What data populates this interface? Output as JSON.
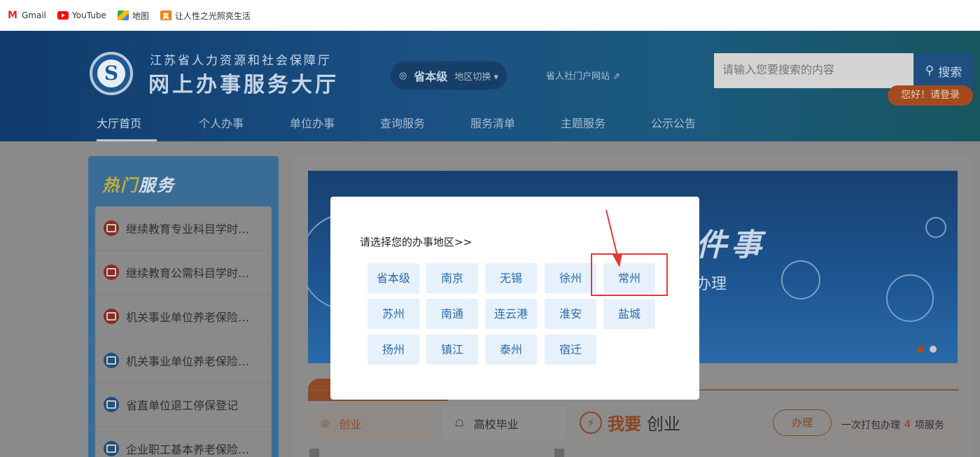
{
  "bookmarks": [
    {
      "label": "Gmail",
      "icon": "gmail-icon",
      "glyph": "M"
    },
    {
      "label": "YouTube",
      "icon": "youtube-icon",
      "glyph": ""
    },
    {
      "label": "地图",
      "icon": "maps-icon",
      "glyph": ""
    },
    {
      "label": "让人性之光照亮生活",
      "icon": "site-icon",
      "glyph": "真"
    }
  ],
  "header": {
    "org_name": "江苏省人力资源和社会保障厅",
    "hall_name": "网上办事服务大厅",
    "logo_glyph": "S",
    "region": {
      "pin": "◎",
      "current": "省本级",
      "switch_label": "地区切换 ▾"
    },
    "portal_link": "省人社门户网站 ⇗",
    "search": {
      "placeholder": "请输入您要搜索的内容",
      "button_label": "搜索",
      "button_icon": "⚲"
    },
    "nav": [
      "大厅首页",
      "个人办事",
      "单位办事",
      "查询服务",
      "服务清单",
      "主题服务",
      "公示公告"
    ],
    "login_label": "您好！请登录"
  },
  "sidebar": {
    "title_em": "热门",
    "title_rest": "服务",
    "items": [
      {
        "label": "继续教育专业科目学时…",
        "color": "red"
      },
      {
        "label": "继续教育公需科目学时…",
        "color": "red"
      },
      {
        "label": "机关事业单位养老保险…",
        "color": "red"
      },
      {
        "label": "机关事业单位养老保险…",
        "color": "blue"
      },
      {
        "label": "省直单位退工停保登记",
        "color": "blue"
      },
      {
        "label": "企业职工基本养老保险…",
        "color": "blue"
      }
    ]
  },
  "banner": {
    "line1": "件事",
    "line2": "办理"
  },
  "categories": {
    "cy": {
      "label": "创业",
      "icon": "◎"
    },
    "gx": {
      "label": "高校毕业",
      "icon": "☖"
    }
  },
  "detail": {
    "title_em": "我要",
    "title_rest": "创业",
    "icon": "⚡",
    "handle_label": "办理",
    "package_prefix": "一次打包办理",
    "package_count": "4",
    "package_suffix": "项服务"
  },
  "modal": {
    "title": "请选择您的办事地区>>",
    "regions": [
      "省本级",
      "南京",
      "无锡",
      "徐州",
      "常州",
      "苏州",
      "南通",
      "连云港",
      "淮安",
      "盐城",
      "扬州",
      "镇江",
      "泰州",
      "宿迁"
    ],
    "highlighted": "常州"
  },
  "colors": {
    "accent_blue": "#2a6bb0",
    "highlight_red": "#e53935",
    "region_bg": "#e7f1fb"
  }
}
